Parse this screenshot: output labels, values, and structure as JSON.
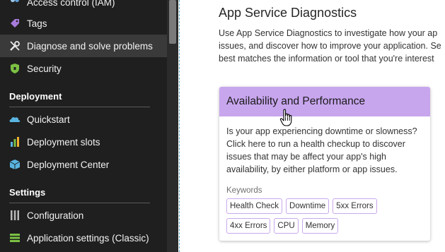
{
  "sidebar": {
    "items": [
      {
        "label": "Access control (IAM)",
        "icon": "people-icon"
      },
      {
        "label": "Tags",
        "icon": "tag-icon"
      },
      {
        "label": "Diagnose and solve problems",
        "icon": "wrench-icon",
        "active": true
      },
      {
        "label": "Security",
        "icon": "shield-icon"
      }
    ],
    "sections": [
      {
        "header": "Deployment",
        "items": [
          {
            "label": "Quickstart",
            "icon": "cloud-icon"
          },
          {
            "label": "Deployment slots",
            "icon": "slots-icon"
          },
          {
            "label": "Deployment Center",
            "icon": "cube-icon"
          }
        ]
      },
      {
        "header": "Settings",
        "items": [
          {
            "label": "Configuration",
            "icon": "bars-icon"
          },
          {
            "label": "Application settings (Classic)",
            "icon": "list-icon"
          }
        ]
      }
    ]
  },
  "main": {
    "title": "App Service Diagnostics",
    "description_lines": [
      "Use App Service Diagnostics to investigate how your ap",
      "issues, and discover how to improve your application. Se",
      "best matches the information or tool that you're interest"
    ],
    "card": {
      "title": "Availability and Performance",
      "body_lines": [
        "Is your app experiencing downtime or slowness?",
        "Click here to run a health checkup to discover",
        "issues that may be affect your app's high",
        "availability, by either platform or app issues."
      ],
      "keywords_label": "Keywords",
      "keywords_row1": [
        "Health Check",
        "Downtime",
        "5xx Errors"
      ],
      "keywords_row2": [
        "4xx Errors",
        "CPU",
        "Memory"
      ]
    }
  },
  "colors": {
    "sidebar_bg": "#1f1f1f",
    "active_item_bg": "#3a3a3a",
    "card_header_bg": "#c8a6ee",
    "keyword_border": "#c9a9ec"
  }
}
